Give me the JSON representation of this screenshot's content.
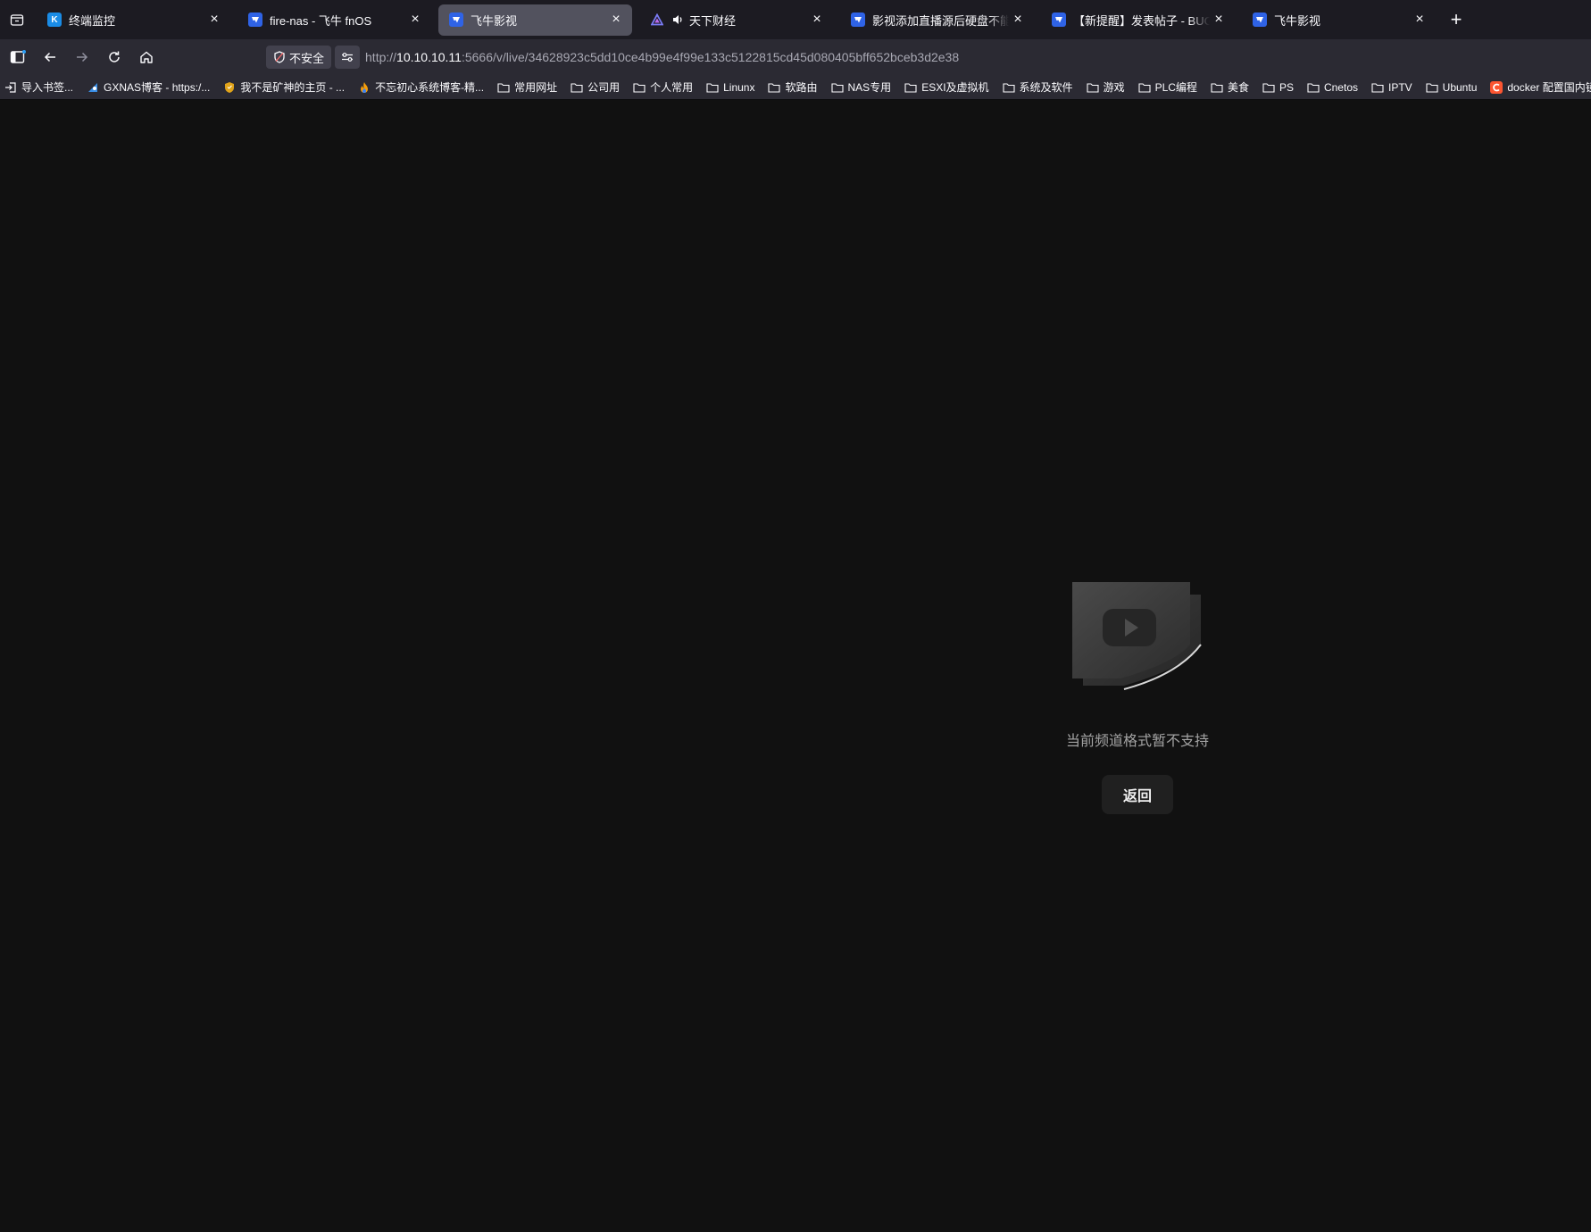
{
  "browser": {
    "tabs": [
      {
        "title": "终端监控",
        "icon": "k-logo-icon",
        "active": false,
        "audio": false
      },
      {
        "title": "fire-nas - 飞牛 fnOS",
        "icon": "fnos-icon",
        "active": false,
        "audio": false
      },
      {
        "title": "飞牛影视",
        "icon": "fnos-icon",
        "active": true,
        "audio": false
      },
      {
        "title": "天下财经",
        "icon": "triangle-icon",
        "active": false,
        "audio": true
      },
      {
        "title": "影视添加直播源后硬盘不能休眠",
        "icon": "fnos-icon",
        "active": false,
        "audio": false
      },
      {
        "title": "【新提醒】发表帖子 - BUG反馈",
        "icon": "fnos-icon",
        "active": false,
        "audio": false
      },
      {
        "title": "飞牛影视",
        "icon": "fnos-icon",
        "active": false,
        "audio": false
      }
    ],
    "new_tab_label": "+",
    "close_glyph": "×",
    "security_label": "不安全",
    "url": {
      "scheme": "http://",
      "host": "10.10.10.11",
      "rest": ":5666/v/live/34628923c5dd10ce4b99e4f99e133c5122815cd45d080405bff652bceb3d2e38"
    },
    "bookmarks": [
      {
        "label": "导入书签...",
        "icon": "import-icon"
      },
      {
        "label": "GXNAS博客 - https:/...",
        "icon": "gxnas-icon"
      },
      {
        "label": "我不是矿神的主页 - ...",
        "icon": "shield-badge-icon"
      },
      {
        "label": "不忘初心系统博客-精...",
        "icon": "flame-icon"
      },
      {
        "label": "常用网址",
        "icon": "folder-icon"
      },
      {
        "label": "公司用",
        "icon": "folder-icon"
      },
      {
        "label": "个人常用",
        "icon": "folder-icon"
      },
      {
        "label": "Linunx",
        "icon": "folder-icon"
      },
      {
        "label": "软路由",
        "icon": "folder-icon"
      },
      {
        "label": "NAS专用",
        "icon": "folder-icon"
      },
      {
        "label": "ESXI及虚拟机",
        "icon": "folder-icon"
      },
      {
        "label": "系统及软件",
        "icon": "folder-icon"
      },
      {
        "label": "游戏",
        "icon": "folder-icon"
      },
      {
        "label": "PLC编程",
        "icon": "folder-icon"
      },
      {
        "label": "美食",
        "icon": "folder-icon"
      },
      {
        "label": "PS",
        "icon": "folder-icon"
      },
      {
        "label": "Cnetos",
        "icon": "folder-icon"
      },
      {
        "label": "IPTV",
        "icon": "folder-icon"
      },
      {
        "label": "Ubuntu",
        "icon": "folder-icon"
      },
      {
        "label": "docker 配置国内镜",
        "icon": "csdn-c-icon"
      }
    ]
  },
  "page": {
    "message": "当前频道格式暂不支持",
    "back_button": "返回"
  },
  "colors": {
    "page_bg": "#111111",
    "tabstrip_bg": "#1c1b22",
    "toolbar_bg": "#2b2a33",
    "active_tab": "#52525e",
    "fav_blue": "#2f63e6"
  }
}
